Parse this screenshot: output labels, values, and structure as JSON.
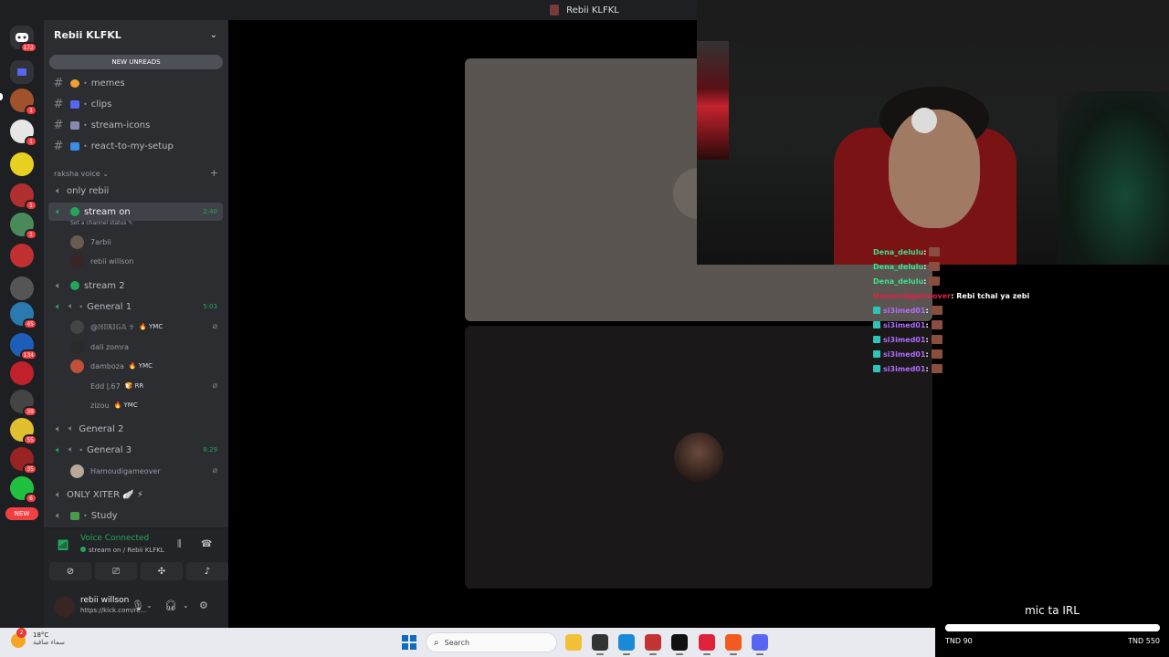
{
  "window": {
    "title": "Rebii KLFKL"
  },
  "rail": {
    "home_badge": "172",
    "new_label": "NEW",
    "servers": [
      {
        "color": "#5865f2",
        "badge": ""
      },
      {
        "color": "#a0522d",
        "badge": "1"
      },
      {
        "color": "#e6e6e6",
        "badge": "1"
      },
      {
        "color": "#e8d020",
        "badge": ""
      },
      {
        "color": "#b03030",
        "badge": "1"
      },
      {
        "color": "#4a8a5a",
        "badge": "1"
      },
      {
        "color": "#c03030",
        "badge": ""
      },
      {
        "color": "#555555",
        "badge": ""
      },
      {
        "color": "#2a7ab0",
        "badge": "45"
      },
      {
        "color": "#1d5fb8",
        "badge": "134"
      },
      {
        "color": "#c0212a",
        "badge": ""
      },
      {
        "color": "#444444",
        "badge": "39"
      },
      {
        "color": "#e0c030",
        "badge": "55"
      },
      {
        "color": "#992222",
        "badge": "35"
      },
      {
        "color": "#20c040",
        "badge": "6"
      }
    ]
  },
  "guild": {
    "name": "Rebii KLFKL",
    "new_unreads": "NEW UNREADS",
    "text_channels": [
      {
        "name": "memes",
        "emoji_color": "#f0a030"
      },
      {
        "name": "clips",
        "emoji_color": "#5865f2"
      },
      {
        "name": "stream-icons",
        "emoji_color": "#8a8ab0"
      },
      {
        "name": "react-to-my-setup",
        "emoji_color": "#3a8ee6"
      }
    ],
    "category": "raksha voice",
    "voice": {
      "only_rebii": "only rebii",
      "stream_on": "stream on",
      "stream_on_time": "2:40",
      "stream_on_status": "Set a channel status",
      "stream_on_users": [
        "7arbii",
        "rebii willson"
      ],
      "stream_2": "stream 2",
      "general_1": "General 1",
      "general_1_time": "5:03",
      "general_1_users": [
        {
          "name": "@ℍ𝕀ℝ𝕀𝔾𝔸 ☥",
          "tag": "🔥 YMC",
          "muted": true
        },
        {
          "name": "dali zomra",
          "tag": "",
          "muted": false
        },
        {
          "name": "damboza",
          "tag": "🔥 YMC",
          "muted": false
        },
        {
          "name": "Edd ɭ.67",
          "tag": "🍞 RR",
          "muted": true
        },
        {
          "name": "zizou",
          "tag": "🔥 YMC",
          "muted": false
        }
      ],
      "general_2": "General 2",
      "general_3": "General 3",
      "general_3_time": "8:29",
      "general_3_users": [
        "Hamoudigameover"
      ],
      "only_xiter": "ONLY XITER 🪽 ⚡",
      "study": "Study"
    }
  },
  "voice_panel": {
    "title": "Voice Connected",
    "subtitle": "stream on / Rebii KLFKL"
  },
  "user_panel": {
    "name": "rebii willson",
    "status": "https://kick.com/re..."
  },
  "chat": [
    {
      "user": "Dena_delulu",
      "color": "#3ee08f",
      "sep": " :",
      "msg": "",
      "emote": true,
      "badge": false
    },
    {
      "user": "Dena_delulu",
      "color": "#3ee08f",
      "sep": " :",
      "msg": "",
      "emote": true,
      "badge": false
    },
    {
      "user": "Dena_delulu",
      "color": "#3ee08f",
      "sep": " :",
      "msg": "",
      "emote": true,
      "badge": false
    },
    {
      "user": "Hamoudigameover",
      "color": "#e0204a",
      "sep": " :",
      "msg": "Rebi tchal ya zebi",
      "emote": false,
      "badge": false
    },
    {
      "user": "si3imed01",
      "color": "#b06cff",
      "sep": " :",
      "msg": "",
      "emote": true,
      "badge": true
    },
    {
      "user": "si3imed01",
      "color": "#b06cff",
      "sep": " :",
      "msg": "",
      "emote": true,
      "badge": true
    },
    {
      "user": "si3imed01",
      "color": "#b06cff",
      "sep": " :",
      "msg": "",
      "emote": true,
      "badge": true
    },
    {
      "user": "si3imed01",
      "color": "#b06cff",
      "sep": " :",
      "msg": "",
      "emote": true,
      "badge": true
    },
    {
      "user": "si3imed01",
      "color": "#b06cff",
      "sep": " :",
      "msg": "",
      "emote": true,
      "badge": true
    }
  ],
  "goal": {
    "title": "mic ta IRL",
    "min": "TND 90",
    "max": "TND 550",
    "progress": 1.0
  },
  "taskbar": {
    "weather_temp": "18°C",
    "weather_desc": "سماء صافية",
    "weather_badge": "2",
    "search_placeholder": "Search",
    "apps": [
      {
        "name": "file-explorer",
        "color": "#f2c037"
      },
      {
        "name": "obs",
        "color": "#333333"
      },
      {
        "name": "edge",
        "color": "#1b8ad6"
      },
      {
        "name": "voicemeeter",
        "color": "#c23333"
      },
      {
        "name": "capcut",
        "color": "#111111"
      },
      {
        "name": "opera",
        "color": "#e0213a"
      },
      {
        "name": "brave",
        "color": "#f25a1f"
      },
      {
        "name": "discord",
        "color": "#5865f2"
      }
    ]
  }
}
